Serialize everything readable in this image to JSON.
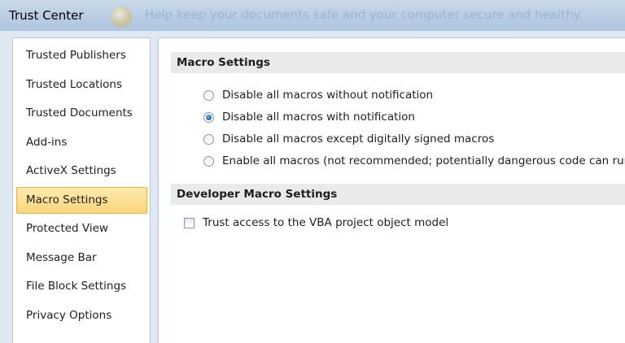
{
  "window": {
    "title": "Trust Center",
    "hint_text": "Help keep your documents safe and your computer secure and healthy."
  },
  "icons": {
    "title_icon": "trust-center-shield-icon"
  },
  "colors": {
    "selected_bg": "#fbd67c",
    "selected_border": "#e7b64a",
    "section_header_bg": "#eaeaea",
    "radio_checked": "#1a5fb4"
  },
  "sidebar": {
    "items": [
      {
        "label": "Trusted Publishers",
        "selected": false
      },
      {
        "label": "Trusted Locations",
        "selected": false
      },
      {
        "label": "Trusted Documents",
        "selected": false
      },
      {
        "label": "Add-ins",
        "selected": false
      },
      {
        "label": "ActiveX Settings",
        "selected": false
      },
      {
        "label": "Macro Settings",
        "selected": true
      },
      {
        "label": "Protected View",
        "selected": false
      },
      {
        "label": "Message Bar",
        "selected": false
      },
      {
        "label": "File Block Settings",
        "selected": false
      },
      {
        "label": "Privacy Options",
        "selected": false
      }
    ]
  },
  "macro_settings": {
    "header": "Macro Settings",
    "selected_option": "Disable all macros with notification",
    "options": [
      {
        "label": "Disable all macros without notification",
        "checked": false
      },
      {
        "label": "Disable all macros with notification",
        "checked": true
      },
      {
        "label": "Disable all macros except digitally signed macros",
        "checked": false
      },
      {
        "label": "Enable all macros (not recommended; potentially dangerous code can run)",
        "checked": false
      }
    ]
  },
  "developer_macro_settings": {
    "header": "Developer Macro Settings",
    "trust_vba": {
      "label": "Trust access to the VBA project object model",
      "checked": false
    }
  }
}
